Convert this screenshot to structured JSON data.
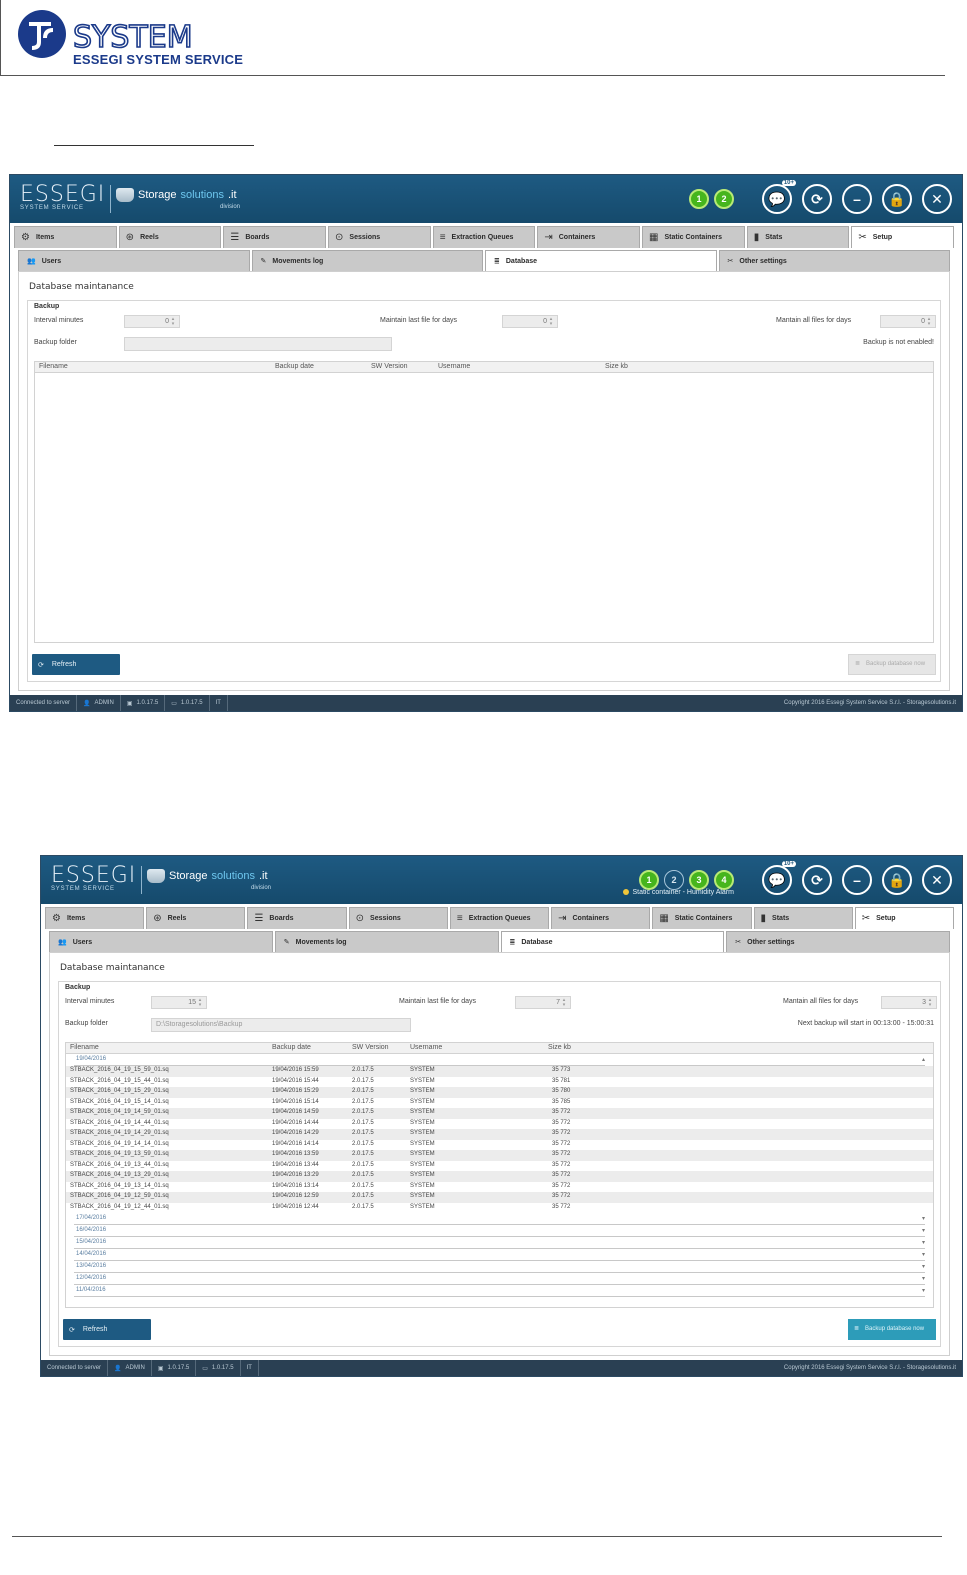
{
  "doc": {
    "logo_text": "SYSTEM",
    "logo_sub": "ESSEGI SYSTEM SERVICE"
  },
  "screens": [
    {
      "brand": "ESSEGI",
      "brand_sub": "SYSTEM SERVICE",
      "product": "Storage",
      "product_accent": "solutions",
      "product_tld": ".it",
      "product_div": "division",
      "badges": [
        "1",
        "2"
      ],
      "notification_count": "10+",
      "status_hint": "",
      "tabs": [
        "Items",
        "Reels",
        "Boards",
        "Sessions",
        "Extraction Queues",
        "Containers",
        "Static Containers",
        "Stats",
        "Setup"
      ],
      "subtabs": [
        "Users",
        "Movements log",
        "Database",
        "Other settings"
      ],
      "section_title": "Database maintanance",
      "backup_title": "Backup",
      "interval_label": "Interval minutes",
      "interval_value": "0",
      "maintain_last_label": "Maintain last file for days",
      "maintain_last_value": "0",
      "maintain_all_label": "Mantain all files for days",
      "maintain_all_value": "0",
      "folder_label": "Backup folder",
      "folder_value": "",
      "right_note": "Backup is not enabled!",
      "columns": [
        "Filename",
        "Backup date",
        "SW Version",
        "Username",
        "Size kb"
      ],
      "refresh_label": "Refresh",
      "backup_label": "Backup database now",
      "status": {
        "conn": "Connected to server",
        "user": "ADMIN",
        "m1": "1.0.17.5",
        "m2": "1.0.17.5",
        "extra": "IT",
        "copyright": "Copyright 2016 Essegi System Service S.r.l. - Storagesolutions.it"
      }
    },
    {
      "brand": "ESSEGI",
      "brand_sub": "SYSTEM SERVICE",
      "product": "Storage",
      "product_accent": "solutions",
      "product_tld": ".it",
      "product_div": "division",
      "badges": [
        "1",
        "2",
        "3",
        "4"
      ],
      "notification_count": "10+",
      "status_hint": "Static container - Humidity Alarm",
      "tabs": [
        "Items",
        "Reels",
        "Boards",
        "Sessions",
        "Extraction Queues",
        "Containers",
        "Static Containers",
        "Stats",
        "Setup"
      ],
      "subtabs": [
        "Users",
        "Movements log",
        "Database",
        "Other settings"
      ],
      "section_title": "Database maintanance",
      "backup_title": "Backup",
      "interval_label": "Interval minutes",
      "interval_value": "15",
      "maintain_last_label": "Maintain last file for days",
      "maintain_last_value": "7",
      "maintain_all_label": "Mantain all files for days",
      "maintain_all_value": "3",
      "folder_label": "Backup folder",
      "folder_value": "D:\\Storagesolutions\\Backup",
      "right_note": "Next backup will start in 00:13:00 - 15:00:31",
      "columns": [
        "Filename",
        "Backup date",
        "SW Version",
        "Username",
        "Size kb"
      ],
      "expanded_date": "19/04/2016",
      "rows": [
        {
          "file": "STBACK_2016_04_19_15_59_01.sq",
          "date": "19/04/2016 15:59",
          "ver": "2.0.17.5",
          "user": "SYSTEM",
          "size": "35 773"
        },
        {
          "file": "STBACK_2016_04_19_15_44_01.sq",
          "date": "19/04/2016 15:44",
          "ver": "2.0.17.5",
          "user": "SYSTEM",
          "size": "35 781"
        },
        {
          "file": "STBACK_2016_04_19_15_29_01.sq",
          "date": "19/04/2016 15:29",
          "ver": "2.0.17.5",
          "user": "SYSTEM",
          "size": "35 780"
        },
        {
          "file": "STBACK_2016_04_19_15_14_01.sq",
          "date": "19/04/2016 15:14",
          "ver": "2.0.17.5",
          "user": "SYSTEM",
          "size": "35 785"
        },
        {
          "file": "STBACK_2016_04_19_14_59_01.sq",
          "date": "19/04/2016 14:59",
          "ver": "2.0.17.5",
          "user": "SYSTEM",
          "size": "35 772"
        },
        {
          "file": "STBACK_2016_04_19_14_44_01.sq",
          "date": "19/04/2016 14:44",
          "ver": "2.0.17.5",
          "user": "SYSTEM",
          "size": "35 772"
        },
        {
          "file": "STBACK_2016_04_19_14_29_01.sq",
          "date": "19/04/2016 14:29",
          "ver": "2.0.17.5",
          "user": "SYSTEM",
          "size": "35 772"
        },
        {
          "file": "STBACK_2016_04_19_14_14_01.sq",
          "date": "19/04/2016 14:14",
          "ver": "2.0.17.5",
          "user": "SYSTEM",
          "size": "35 772"
        },
        {
          "file": "STBACK_2016_04_19_13_59_01.sq",
          "date": "19/04/2016 13:59",
          "ver": "2.0.17.5",
          "user": "SYSTEM",
          "size": "35 772"
        },
        {
          "file": "STBACK_2016_04_19_13_44_01.sq",
          "date": "19/04/2016 13:44",
          "ver": "2.0.17.5",
          "user": "SYSTEM",
          "size": "35 772"
        },
        {
          "file": "STBACK_2016_04_19_13_29_01.sq",
          "date": "19/04/2016 13:29",
          "ver": "2.0.17.5",
          "user": "SYSTEM",
          "size": "35 772"
        },
        {
          "file": "STBACK_2016_04_19_13_14_01.sq",
          "date": "19/04/2016 13:14",
          "ver": "2.0.17.5",
          "user": "SYSTEM",
          "size": "35 772"
        },
        {
          "file": "STBACK_2016_04_19_12_59_01.sq",
          "date": "19/04/2016 12:59",
          "ver": "2.0.17.5",
          "user": "SYSTEM",
          "size": "35 772"
        },
        {
          "file": "STBACK_2016_04_19_12_44_01.sq",
          "date": "19/04/2016 12:44",
          "ver": "2.0.17.5",
          "user": "SYSTEM",
          "size": "35 772"
        }
      ],
      "collapsed_dates": [
        "17/04/2016",
        "16/04/2016",
        "15/04/2016",
        "14/04/2016",
        "13/04/2016",
        "12/04/2016",
        "11/04/2016"
      ],
      "refresh_label": "Refresh",
      "backup_label": "Backup database now",
      "status": {
        "conn": "Connected to server",
        "user": "ADMIN",
        "m1": "1.0.17.5",
        "m2": "1.0.17.5",
        "extra": "IT",
        "copyright": "Copyright 2016 Essegi System Service S.r.l. - Storagesolutions.it"
      }
    }
  ]
}
